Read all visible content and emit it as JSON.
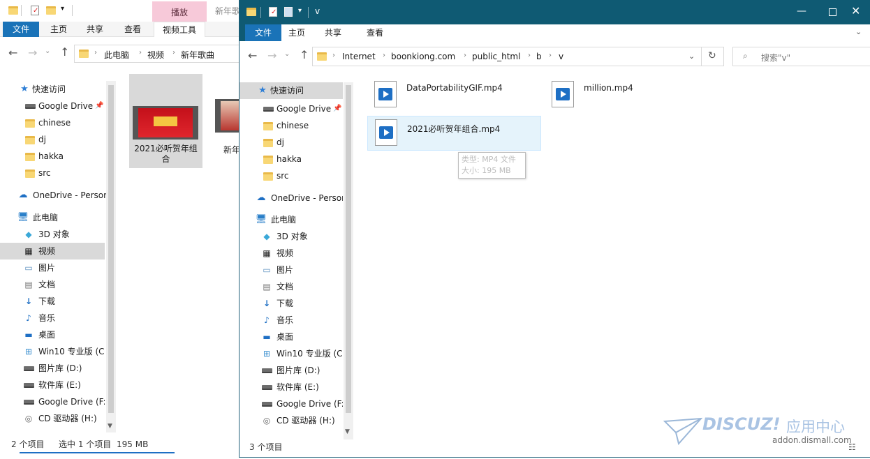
{
  "left_window": {
    "title_partial": "新年歌",
    "ribbon": {
      "tabs": [
        "文件",
        "主页",
        "共享",
        "查看",
        "视频工具"
      ],
      "contextual_tab": "播放"
    },
    "breadcrumb": [
      "此电脑",
      "视频",
      "新年歌曲"
    ],
    "nav": {
      "quick_access": "快速访问",
      "quick_items": [
        "Google Drive",
        "chinese",
        "dj",
        "hakka",
        "src"
      ],
      "onedrive": "OneDrive - Persor",
      "this_pc": "此电脑",
      "pc_items": [
        "3D 对象",
        "视频",
        "图片",
        "文档",
        "下载",
        "音乐",
        "桌面",
        "Win10 专业版 (C:",
        "图片库 (D:)",
        "软件库 (E:)",
        "Google Drive (F:",
        "CD 驱动器 (H:)"
      ]
    },
    "files": [
      {
        "name": "2021必听贺年组合",
        "selected": true
      },
      {
        "name": "新年",
        "selected": false
      }
    ],
    "status": {
      "count": "2 个项目",
      "selected": "选中 1 个项目",
      "size": "195 MB"
    }
  },
  "right_window": {
    "title": "v",
    "ribbon": {
      "tabs": [
        "文件",
        "主页",
        "共享",
        "查看"
      ]
    },
    "breadcrumb": [
      "Internet",
      "boonkiong.com",
      "public_html",
      "b",
      "v"
    ],
    "search_placeholder": "搜索\"v\"",
    "nav": {
      "quick_access": "快速访问",
      "quick_items": [
        "Google Drive",
        "chinese",
        "dj",
        "hakka",
        "src"
      ],
      "onedrive": "OneDrive - Persor",
      "this_pc": "此电脑",
      "pc_items": [
        "3D 对象",
        "视频",
        "图片",
        "文档",
        "下载",
        "音乐",
        "桌面",
        "Win10 专业版 (C:",
        "图片库 (D:)",
        "软件库 (E:)",
        "Google Drive (F:",
        "CD 驱动器 (H:)"
      ]
    },
    "files": [
      {
        "name": "DataPortabilityGIF.mp4"
      },
      {
        "name": "million.mp4"
      },
      {
        "name": "2021必听贺年组合.mp4"
      }
    ],
    "tooltip": {
      "type": "类型: MP4 文件",
      "size": "大小: 195 MB"
    },
    "status": {
      "count": "3 个项目"
    }
  },
  "watermark": {
    "brand": "DISCUZ!",
    "suffix": "应用中心",
    "url": "addon.dismall.com"
  },
  "colors": {
    "titlebar": "#0f5a73",
    "selection": "#cce8ff",
    "accent": "#1e6fc4",
    "ribbon_file": "#1a73b8"
  }
}
